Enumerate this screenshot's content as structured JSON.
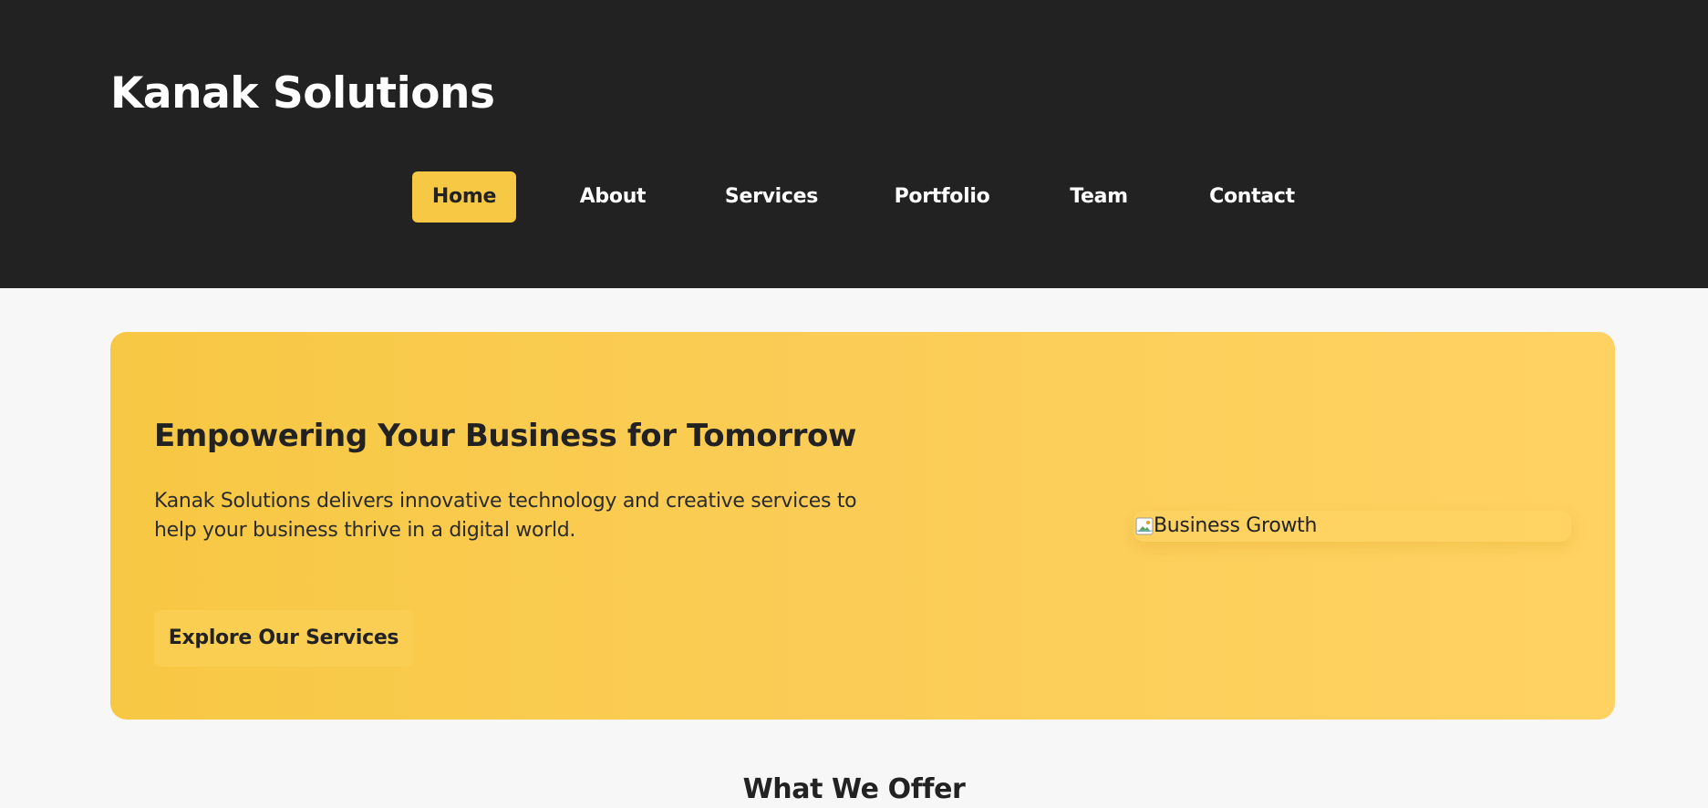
{
  "header": {
    "brand": "Kanak Solutions",
    "nav": [
      {
        "label": "Home",
        "active": true
      },
      {
        "label": "About",
        "active": false
      },
      {
        "label": "Services",
        "active": false
      },
      {
        "label": "Portfolio",
        "active": false
      },
      {
        "label": "Team",
        "active": false
      },
      {
        "label": "Contact",
        "active": false
      }
    ]
  },
  "hero": {
    "title": "Empowering Your Business for Tomorrow",
    "text": "Kanak Solutions delivers innovative technology and creative services to help your business thrive in a digital world.",
    "cta_label": "Explore Our Services",
    "image_alt": "Business Growth"
  },
  "next_section": {
    "heading": "What We Offer"
  },
  "colors": {
    "header_bg": "#222222",
    "accent": "#f7c843",
    "page_bg": "#f7f7f7",
    "text": "#222222"
  }
}
